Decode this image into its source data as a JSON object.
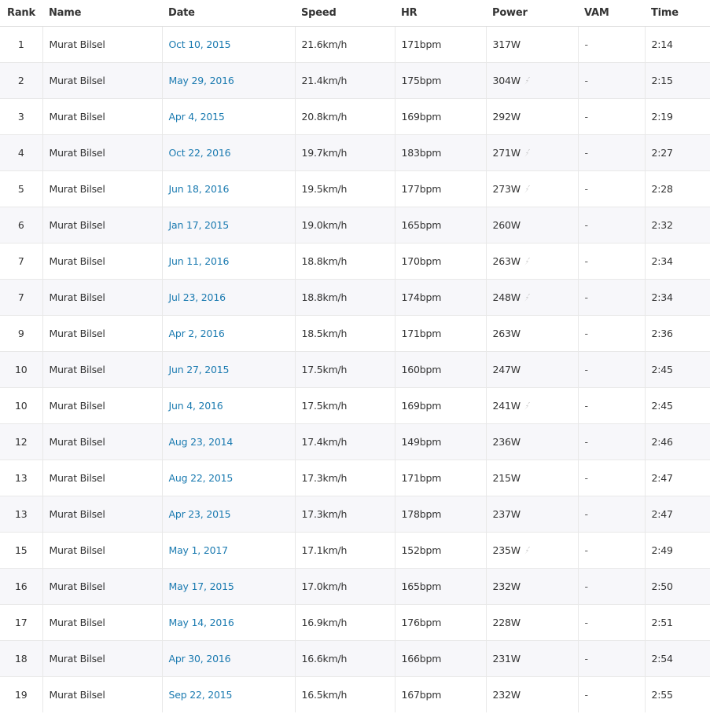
{
  "columns": {
    "rank": "Rank",
    "name": "Name",
    "date": "Date",
    "speed": "Speed",
    "hr": "HR",
    "power": "Power",
    "vam": "VAM",
    "time": "Time"
  },
  "icon_names": {
    "estimated_power": "lightning-bolt-icon"
  },
  "colors": {
    "link": "#1a7ab0",
    "row_alt": "#f7f7fa",
    "bolt": "#b5b5b5"
  },
  "rows": [
    {
      "rank": "1",
      "name": "Murat Bilsel",
      "date": "Oct 10, 2015",
      "speed": "21.6km/h",
      "hr": "171bpm",
      "power": "317W",
      "estimated": false,
      "vam": "-",
      "time": "2:14"
    },
    {
      "rank": "2",
      "name": "Murat Bilsel",
      "date": "May 29, 2016",
      "speed": "21.4km/h",
      "hr": "175bpm",
      "power": "304W",
      "estimated": true,
      "vam": "-",
      "time": "2:15"
    },
    {
      "rank": "3",
      "name": "Murat Bilsel",
      "date": "Apr 4, 2015",
      "speed": "20.8km/h",
      "hr": "169bpm",
      "power": "292W",
      "estimated": false,
      "vam": "-",
      "time": "2:19"
    },
    {
      "rank": "4",
      "name": "Murat Bilsel",
      "date": "Oct 22, 2016",
      "speed": "19.7km/h",
      "hr": "183bpm",
      "power": "271W",
      "estimated": true,
      "vam": "-",
      "time": "2:27"
    },
    {
      "rank": "5",
      "name": "Murat Bilsel",
      "date": "Jun 18, 2016",
      "speed": "19.5km/h",
      "hr": "177bpm",
      "power": "273W",
      "estimated": true,
      "vam": "-",
      "time": "2:28"
    },
    {
      "rank": "6",
      "name": "Murat Bilsel",
      "date": "Jan 17, 2015",
      "speed": "19.0km/h",
      "hr": "165bpm",
      "power": "260W",
      "estimated": false,
      "vam": "-",
      "time": "2:32"
    },
    {
      "rank": "7",
      "name": "Murat Bilsel",
      "date": "Jun 11, 2016",
      "speed": "18.8km/h",
      "hr": "170bpm",
      "power": "263W",
      "estimated": true,
      "vam": "-",
      "time": "2:34"
    },
    {
      "rank": "7",
      "name": "Murat Bilsel",
      "date": "Jul 23, 2016",
      "speed": "18.8km/h",
      "hr": "174bpm",
      "power": "248W",
      "estimated": true,
      "vam": "-",
      "time": "2:34"
    },
    {
      "rank": "9",
      "name": "Murat Bilsel",
      "date": "Apr 2, 2016",
      "speed": "18.5km/h",
      "hr": "171bpm",
      "power": "263W",
      "estimated": false,
      "vam": "-",
      "time": "2:36"
    },
    {
      "rank": "10",
      "name": "Murat Bilsel",
      "date": "Jun 27, 2015",
      "speed": "17.5km/h",
      "hr": "160bpm",
      "power": "247W",
      "estimated": false,
      "vam": "-",
      "time": "2:45"
    },
    {
      "rank": "10",
      "name": "Murat Bilsel",
      "date": "Jun 4, 2016",
      "speed": "17.5km/h",
      "hr": "169bpm",
      "power": "241W",
      "estimated": true,
      "vam": "-",
      "time": "2:45"
    },
    {
      "rank": "12",
      "name": "Murat Bilsel",
      "date": "Aug 23, 2014",
      "speed": "17.4km/h",
      "hr": "149bpm",
      "power": "236W",
      "estimated": false,
      "vam": "-",
      "time": "2:46"
    },
    {
      "rank": "13",
      "name": "Murat Bilsel",
      "date": "Aug 22, 2015",
      "speed": "17.3km/h",
      "hr": "171bpm",
      "power": "215W",
      "estimated": false,
      "vam": "-",
      "time": "2:47"
    },
    {
      "rank": "13",
      "name": "Murat Bilsel",
      "date": "Apr 23, 2015",
      "speed": "17.3km/h",
      "hr": "178bpm",
      "power": "237W",
      "estimated": false,
      "vam": "-",
      "time": "2:47"
    },
    {
      "rank": "15",
      "name": "Murat Bilsel",
      "date": "May 1, 2017",
      "speed": "17.1km/h",
      "hr": "152bpm",
      "power": "235W",
      "estimated": true,
      "vam": "-",
      "time": "2:49"
    },
    {
      "rank": "16",
      "name": "Murat Bilsel",
      "date": "May 17, 2015",
      "speed": "17.0km/h",
      "hr": "165bpm",
      "power": "232W",
      "estimated": false,
      "vam": "-",
      "time": "2:50"
    },
    {
      "rank": "17",
      "name": "Murat Bilsel",
      "date": "May 14, 2016",
      "speed": "16.9km/h",
      "hr": "176bpm",
      "power": "228W",
      "estimated": false,
      "vam": "-",
      "time": "2:51"
    },
    {
      "rank": "18",
      "name": "Murat Bilsel",
      "date": "Apr 30, 2016",
      "speed": "16.6km/h",
      "hr": "166bpm",
      "power": "231W",
      "estimated": false,
      "vam": "-",
      "time": "2:54"
    },
    {
      "rank": "19",
      "name": "Murat Bilsel",
      "date": "Sep 22, 2015",
      "speed": "16.5km/h",
      "hr": "167bpm",
      "power": "232W",
      "estimated": false,
      "vam": "-",
      "time": "2:55"
    }
  ]
}
